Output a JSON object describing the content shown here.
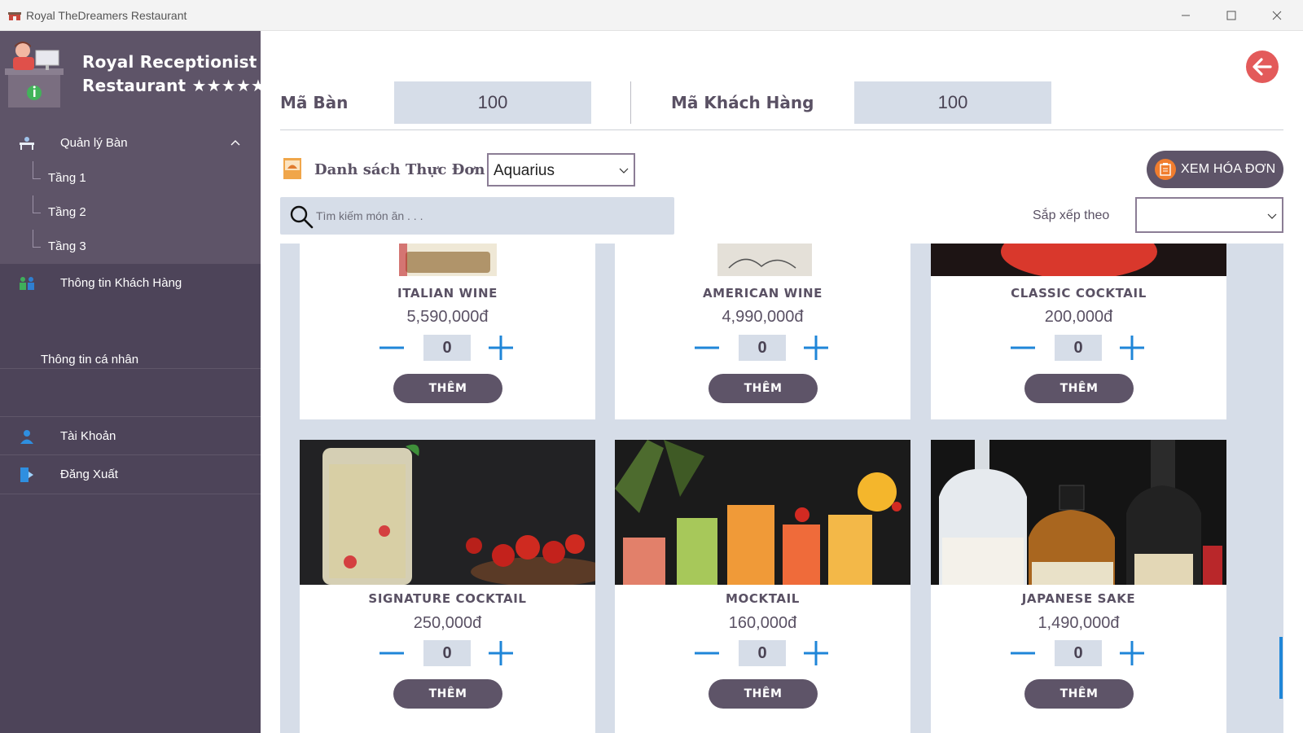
{
  "window": {
    "title": "Royal TheDreamers Restaurant"
  },
  "brand": {
    "line1": "Royal Receptionist",
    "line2": "Restaurant ★★★★★"
  },
  "sidebar": {
    "group": {
      "label": "Quản lý Bàn",
      "expanded": true
    },
    "floors": [
      "Tầng 1",
      "Tầng 2",
      "Tầng 3"
    ],
    "customer_info": "Thông tin Khách Hàng",
    "personal_info": "Thông tin cá nhân",
    "account": "Tài Khoản",
    "logout": "Đăng Xuất"
  },
  "header": {
    "table_label": "Mã Bàn",
    "table_value": "100",
    "customer_label": "Mã Khách Hàng",
    "customer_value": "100"
  },
  "menu": {
    "title": "Danh sách Thực Đơn",
    "selected": "Aquarius",
    "invoice_button": "XEM HÓA ĐƠN",
    "search_placeholder": "Tìm kiếm món ăn . . .",
    "sort_label": "Sắp xếp theo",
    "sort_value": ""
  },
  "products": [
    {
      "name": "ITALIAN WINE",
      "price": "5,590,000đ",
      "qty": "0",
      "add": "THÊM",
      "image": "wine-bottle-label"
    },
    {
      "name": "AMERICAN WINE",
      "price": "4,990,000đ",
      "qty": "0",
      "add": "THÊM",
      "image": "wine-bottle-label"
    },
    {
      "name": "CLASSIC COCKTAIL",
      "price": "200,000đ",
      "qty": "0",
      "add": "THÊM",
      "image": "red-cocktail"
    },
    {
      "name": "SIGNATURE COCKTAIL",
      "price": "250,000đ",
      "qty": "0",
      "add": "THÊM",
      "image": "cocktail-tomatoes"
    },
    {
      "name": "MOCKTAIL",
      "price": "160,000đ",
      "qty": "0",
      "add": "THÊM",
      "image": "mocktail-glasses"
    },
    {
      "name": "JAPANESE SAKE",
      "price": "1,490,000đ",
      "qty": "0",
      "add": "THÊM",
      "image": "sake-bottles"
    }
  ],
  "colors": {
    "sidebar": "#4d4459",
    "sidebar_active": "#5e5468",
    "accent": "#5e5468",
    "input_bg": "#d6dde8",
    "back_button": "#e35a5a",
    "stepper": "#1f86d8"
  }
}
